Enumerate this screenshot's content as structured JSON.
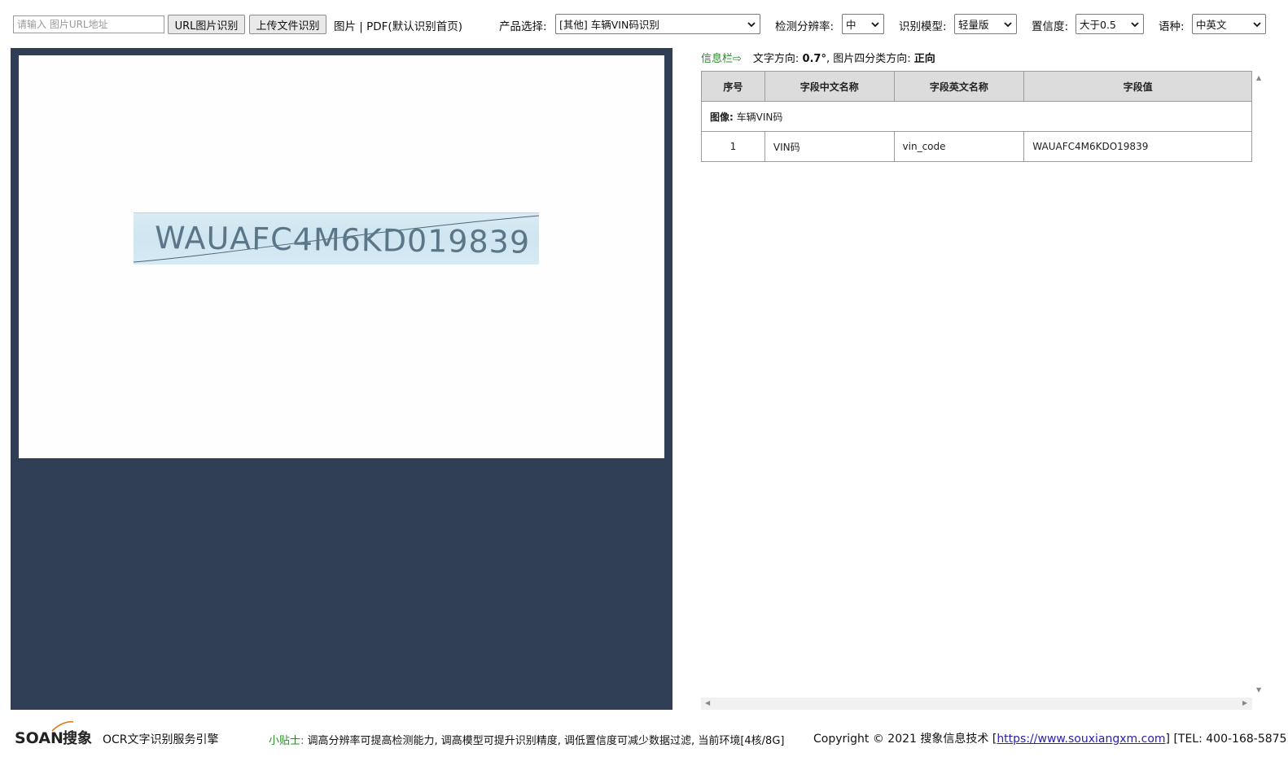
{
  "toolbar": {
    "url_placeholder": "请输入 图片URL地址",
    "url_button": "URL图片识别",
    "upload_button": "上传文件识别",
    "filetype_hint": "图片 | PDF(默认识别首页)",
    "product_label": "产品选择:",
    "product_value": "[其他] 车辆VIN码识别",
    "resolution_label": "检测分辨率:",
    "resolution_value": "中",
    "model_label": "识别模型:",
    "model_value": "轻量版",
    "confidence_label": "置信度:",
    "confidence_value": "大于0.5",
    "language_label": "语种:",
    "language_value": "中英文"
  },
  "preview": {
    "image_text": "WAUAFC4M6KD019839",
    "colors": {
      "panel_bg": "#2f3e55",
      "canvas_bg": "#fefefe"
    }
  },
  "info": {
    "title": "信息栏⇨",
    "direction_label": "文字方向:",
    "direction_value": "0.7°",
    "quad_label": "图片四分类方向:",
    "quad_value": "正向"
  },
  "table": {
    "headers": [
      "序号",
      "字段中文名称",
      "字段英文名称",
      "字段值"
    ],
    "group_label": "图像:",
    "group_value": "车辆VIN码",
    "rows": [
      {
        "index": "1",
        "name_cn": "VIN码",
        "name_en": "vin_code",
        "value": "WAUAFC4M6KDO19839"
      }
    ]
  },
  "footer": {
    "logo_text": "SOAN搜象",
    "engine_text": "OCR文字识别服务引擎",
    "tip_label": "小贴士:",
    "tip_text": "调高分辨率可提高检测能力, 调高模型可提升识别精度, 调低置信度可减少数据过滤, 当前环境[4核/8G]",
    "copyright_prefix": "Copyright © 2021 搜象信息技术 [",
    "copyright_link": "https://www.souxiangxm.com",
    "copyright_suffix": "] [TEL: 400-168-5875]"
  }
}
